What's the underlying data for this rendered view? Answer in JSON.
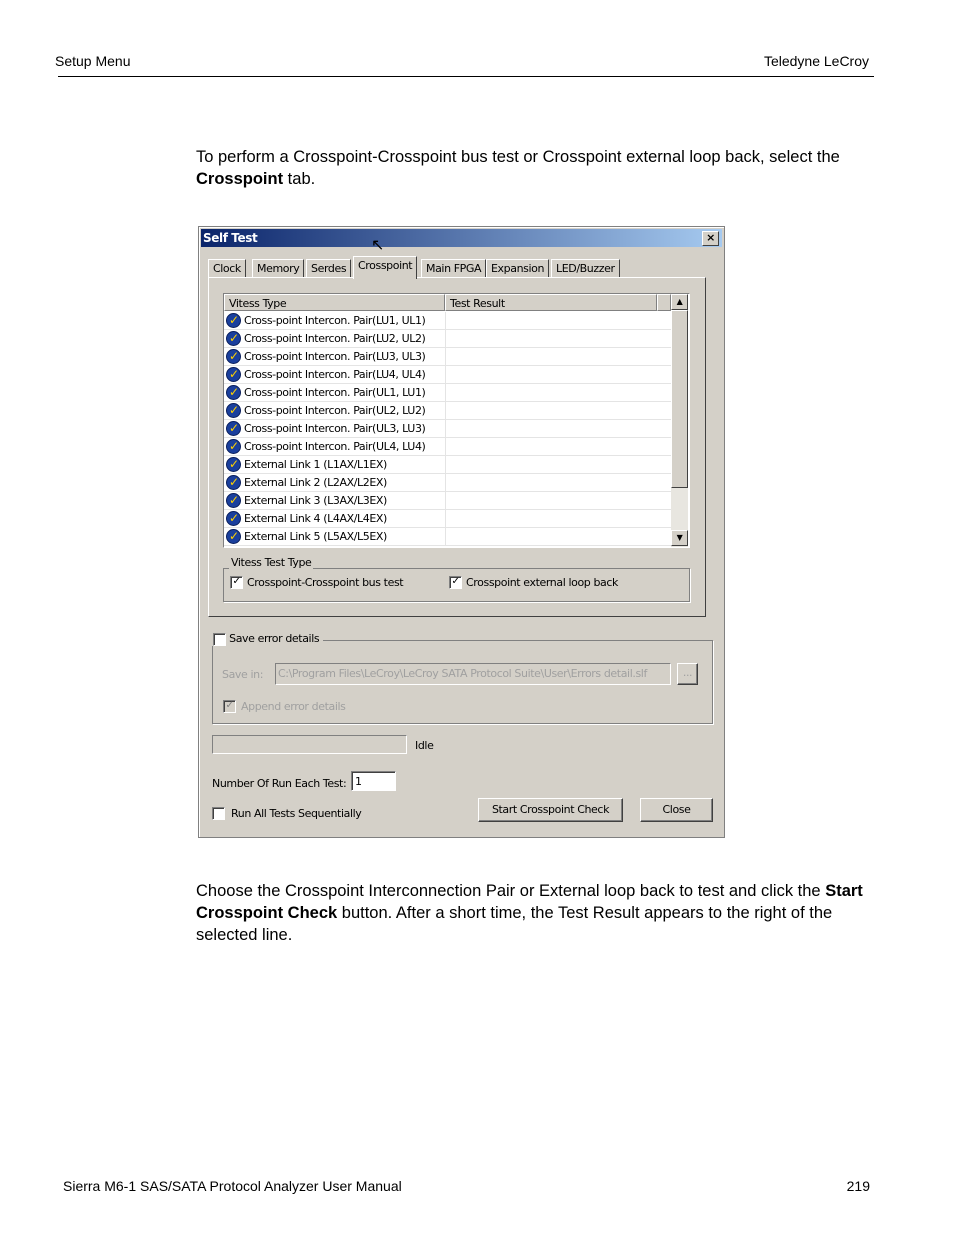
{
  "header": {
    "left": "Setup Menu",
    "right": "Teledyne LeCroy"
  },
  "intro": {
    "text": "To perform a Crosspoint-Crosspoint bus test or Crosspoint external loop back, select the ",
    "bold": "Crosspoint",
    "after": " tab."
  },
  "dialog": {
    "title": "Self Test",
    "close_glyph": "×",
    "tabs": [
      "Clock",
      "Memory",
      "Serdes",
      "Crosspoint",
      "Main FPGA",
      "Expansion",
      "LED/Buzzer"
    ],
    "active_tab": "Crosspoint",
    "columns": [
      "Vitess Type",
      "Test Result"
    ],
    "rows": [
      {
        "icon": "check-badge-icon",
        "type": "Cross-point Intercon. Pair(LU1, UL1)",
        "result": ""
      },
      {
        "icon": "check-badge-icon",
        "type": "Cross-point Intercon. Pair(LU2, UL2)",
        "result": ""
      },
      {
        "icon": "check-badge-icon",
        "type": "Cross-point Intercon. Pair(LU3, UL3)",
        "result": ""
      },
      {
        "icon": "check-badge-icon",
        "type": "Cross-point Intercon. Pair(LU4, UL4)",
        "result": ""
      },
      {
        "icon": "check-badge-icon",
        "type": "Cross-point Intercon. Pair(UL1, LU1)",
        "result": ""
      },
      {
        "icon": "check-badge-icon",
        "type": "Cross-point Intercon. Pair(UL2, LU2)",
        "result": ""
      },
      {
        "icon": "check-badge-icon",
        "type": "Cross-point Intercon. Pair(UL3, LU3)",
        "result": ""
      },
      {
        "icon": "check-badge-icon",
        "type": "Cross-point Intercon. Pair(UL4, LU4)",
        "result": ""
      },
      {
        "icon": "check-badge-icon",
        "type": "External Link 1 (L1AX/L1EX)",
        "result": ""
      },
      {
        "icon": "check-badge-icon",
        "type": "External Link 2 (L2AX/L2EX)",
        "result": ""
      },
      {
        "icon": "check-badge-icon",
        "type": "External Link 3 (L3AX/L3EX)",
        "result": ""
      },
      {
        "icon": "check-badge-icon",
        "type": "External Link 4 (L4AX/L4EX)",
        "result": ""
      },
      {
        "icon": "check-badge-icon",
        "type": "External Link 5 (L5AX/L5EX)",
        "result": ""
      }
    ],
    "test_type_group": "Vitess Test Type",
    "bus_test": {
      "label": "Crosspoint-Crosspoint bus test",
      "checked": true
    },
    "loop_back": {
      "label": "Crosspoint external loop back",
      "checked": true
    },
    "save_error": {
      "label": "Save error details",
      "checked": false
    },
    "save_in_label": "Save in:",
    "save_in_value": "C:\\Program Files\\LeCroy\\LeCroy SATA Protocol Suite\\User\\Errors detail.slf",
    "browse_label": "...",
    "append": {
      "label": "Append error details",
      "checked": true
    },
    "progress": 0,
    "status": "Idle",
    "runs_label": "Number Of Run Each Test:",
    "runs_value": "1",
    "sequential": {
      "label": "Run All Tests Sequentially",
      "checked": false
    },
    "start_label": "Start Crosspoint Check",
    "close_label": "Close"
  },
  "outro": {
    "t1": "Choose the Crosspoint Interconnection Pair or External loop back to test and click the ",
    "bold": "Start Crosspoint Check",
    "t2": " button. After a short time, the Test Result appears to the right of the selected line."
  },
  "footer": {
    "left": "Sierra M6-1 SAS/SATA Protocol Analyzer User Manual",
    "right": "219"
  }
}
